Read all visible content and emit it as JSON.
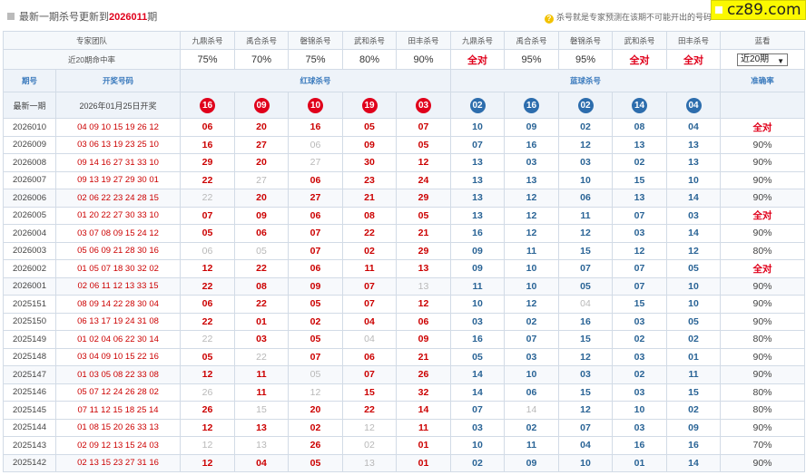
{
  "topbar": {
    "title_prefix": "最新一期杀号更新到",
    "title_period": "2026011",
    "title_suffix": "期",
    "note": "杀号就是专家预测在该期不可能开出的号码",
    "site_badge": "cz89.com"
  },
  "team_row": {
    "label": "专家团队",
    "experts": [
      "九鼎杀号",
      "禹合杀号",
      "磐锦杀号",
      "武和杀号",
      "田丰杀号",
      "九鼎杀号",
      "禹合杀号",
      "磐锦杀号",
      "武和杀号",
      "田丰杀号"
    ],
    "last_label": "蓝看"
  },
  "rate_row": {
    "label": "近20期命中率",
    "rates": [
      "75%",
      "70%",
      "75%",
      "80%",
      "90%",
      "全对",
      "95%",
      "95%",
      "全对",
      "全对"
    ],
    "select_value": "近20期"
  },
  "header_row": {
    "period": "期号",
    "draw": "开奖号码",
    "red_kill": "红球杀号",
    "blue_kill": "蓝球杀号",
    "accuracy": "准确率"
  },
  "latest": {
    "period": "最新一期",
    "draw": "2026年01月25日开奖",
    "red": [
      "16",
      "09",
      "10",
      "19",
      "03"
    ],
    "blue": [
      "02",
      "16",
      "02",
      "14",
      "04"
    ]
  },
  "rows": [
    {
      "period": "2026010",
      "draw": "04 09 10 15 19 26 12",
      "cells": [
        [
          "06",
          "r"
        ],
        [
          "20",
          "r"
        ],
        [
          "16",
          "r"
        ],
        [
          "05",
          "r"
        ],
        [
          "07",
          "r"
        ],
        [
          "10",
          "b"
        ],
        [
          "09",
          "b"
        ],
        [
          "02",
          "b"
        ],
        [
          "08",
          "b"
        ],
        [
          "04",
          "b"
        ]
      ],
      "acc": "全对"
    },
    {
      "period": "2026009",
      "draw": "03 06 13 19 23 25 10",
      "cells": [
        [
          "16",
          "r"
        ],
        [
          "27",
          "r"
        ],
        [
          "06",
          "m"
        ],
        [
          "09",
          "r"
        ],
        [
          "05",
          "r"
        ],
        [
          "07",
          "b"
        ],
        [
          "16",
          "b"
        ],
        [
          "12",
          "b"
        ],
        [
          "13",
          "b"
        ],
        [
          "13",
          "b"
        ]
      ],
      "acc": "90%"
    },
    {
      "period": "2026008",
      "draw": "09 14 16 27 31 33 10",
      "cells": [
        [
          "29",
          "r"
        ],
        [
          "20",
          "r"
        ],
        [
          "27",
          "m"
        ],
        [
          "30",
          "r"
        ],
        [
          "12",
          "r"
        ],
        [
          "13",
          "b"
        ],
        [
          "03",
          "b"
        ],
        [
          "03",
          "b"
        ],
        [
          "02",
          "b"
        ],
        [
          "13",
          "b"
        ]
      ],
      "acc": "90%"
    },
    {
      "period": "2026007",
      "draw": "09 13 19 27 29 30 01",
      "cells": [
        [
          "22",
          "r"
        ],
        [
          "27",
          "m"
        ],
        [
          "06",
          "r"
        ],
        [
          "23",
          "r"
        ],
        [
          "24",
          "r"
        ],
        [
          "13",
          "b"
        ],
        [
          "13",
          "b"
        ],
        [
          "10",
          "b"
        ],
        [
          "15",
          "b"
        ],
        [
          "10",
          "b"
        ]
      ],
      "acc": "90%"
    },
    {
      "period": "2026006",
      "draw": "02 06 22 23 24 28 15",
      "cells": [
        [
          "22",
          "m"
        ],
        [
          "20",
          "r"
        ],
        [
          "27",
          "r"
        ],
        [
          "21",
          "r"
        ],
        [
          "29",
          "r"
        ],
        [
          "13",
          "b"
        ],
        [
          "12",
          "b"
        ],
        [
          "06",
          "b"
        ],
        [
          "13",
          "b"
        ],
        [
          "14",
          "b"
        ]
      ],
      "acc": "90%"
    },
    {
      "period": "2026005",
      "draw": "01 20 22 27 30 33 10",
      "cells": [
        [
          "07",
          "r"
        ],
        [
          "09",
          "r"
        ],
        [
          "06",
          "r"
        ],
        [
          "08",
          "r"
        ],
        [
          "05",
          "r"
        ],
        [
          "13",
          "b"
        ],
        [
          "12",
          "b"
        ],
        [
          "11",
          "b"
        ],
        [
          "07",
          "b"
        ],
        [
          "03",
          "b"
        ]
      ],
      "acc": "全对"
    },
    {
      "period": "2026004",
      "draw": "03 07 08 09 15 24 12",
      "cells": [
        [
          "05",
          "r"
        ],
        [
          "06",
          "r"
        ],
        [
          "07",
          "r"
        ],
        [
          "22",
          "r"
        ],
        [
          "21",
          "r"
        ],
        [
          "16",
          "b"
        ],
        [
          "12",
          "b"
        ],
        [
          "12",
          "b"
        ],
        [
          "03",
          "b"
        ],
        [
          "14",
          "b"
        ]
      ],
      "acc": "90%"
    },
    {
      "period": "2026003",
      "draw": "05 06 09 21 28 30 16",
      "cells": [
        [
          "06",
          "m"
        ],
        [
          "05",
          "m"
        ],
        [
          "07",
          "r"
        ],
        [
          "02",
          "r"
        ],
        [
          "29",
          "r"
        ],
        [
          "09",
          "b"
        ],
        [
          "11",
          "b"
        ],
        [
          "15",
          "b"
        ],
        [
          "12",
          "b"
        ],
        [
          "12",
          "b"
        ]
      ],
      "acc": "80%"
    },
    {
      "period": "2026002",
      "draw": "01 05 07 18 30 32 02",
      "cells": [
        [
          "12",
          "r"
        ],
        [
          "22",
          "r"
        ],
        [
          "06",
          "r"
        ],
        [
          "11",
          "r"
        ],
        [
          "13",
          "r"
        ],
        [
          "09",
          "b"
        ],
        [
          "10",
          "b"
        ],
        [
          "07",
          "b"
        ],
        [
          "07",
          "b"
        ],
        [
          "05",
          "b"
        ]
      ],
      "acc": "全对"
    },
    {
      "period": "2026001",
      "draw": "02 06 11 12 13 33 15",
      "cells": [
        [
          "22",
          "r"
        ],
        [
          "08",
          "r"
        ],
        [
          "09",
          "r"
        ],
        [
          "07",
          "r"
        ],
        [
          "13",
          "m"
        ],
        [
          "11",
          "b"
        ],
        [
          "10",
          "b"
        ],
        [
          "05",
          "b"
        ],
        [
          "07",
          "b"
        ],
        [
          "10",
          "b"
        ]
      ],
      "acc": "90%"
    },
    {
      "period": "2025151",
      "draw": "08 09 14 22 28 30 04",
      "cells": [
        [
          "06",
          "r"
        ],
        [
          "22",
          "r"
        ],
        [
          "05",
          "r"
        ],
        [
          "07",
          "r"
        ],
        [
          "12",
          "r"
        ],
        [
          "10",
          "b"
        ],
        [
          "12",
          "b"
        ],
        [
          "04",
          "m"
        ],
        [
          "15",
          "b"
        ],
        [
          "10",
          "b"
        ]
      ],
      "acc": "90%"
    },
    {
      "period": "2025150",
      "draw": "06 13 17 19 24 31 08",
      "cells": [
        [
          "22",
          "r"
        ],
        [
          "01",
          "r"
        ],
        [
          "02",
          "r"
        ],
        [
          "04",
          "r"
        ],
        [
          "06",
          "r"
        ],
        [
          "03",
          "b"
        ],
        [
          "02",
          "b"
        ],
        [
          "16",
          "b"
        ],
        [
          "03",
          "b"
        ],
        [
          "05",
          "b"
        ]
      ],
      "acc": "90%"
    },
    {
      "period": "2025149",
      "draw": "01 02 04 06 22 30 14",
      "cells": [
        [
          "22",
          "m"
        ],
        [
          "03",
          "r"
        ],
        [
          "05",
          "r"
        ],
        [
          "04",
          "m"
        ],
        [
          "09",
          "r"
        ],
        [
          "16",
          "b"
        ],
        [
          "07",
          "b"
        ],
        [
          "15",
          "b"
        ],
        [
          "02",
          "b"
        ],
        [
          "02",
          "b"
        ]
      ],
      "acc": "80%"
    },
    {
      "period": "2025148",
      "draw": "03 04 09 10 15 22 16",
      "cells": [
        [
          "05",
          "r"
        ],
        [
          "22",
          "m"
        ],
        [
          "07",
          "r"
        ],
        [
          "06",
          "r"
        ],
        [
          "21",
          "r"
        ],
        [
          "05",
          "b"
        ],
        [
          "03",
          "b"
        ],
        [
          "12",
          "b"
        ],
        [
          "03",
          "b"
        ],
        [
          "01",
          "b"
        ]
      ],
      "acc": "90%"
    },
    {
      "period": "2025147",
      "draw": "01 03 05 08 22 33 08",
      "cells": [
        [
          "12",
          "r"
        ],
        [
          "11",
          "r"
        ],
        [
          "05",
          "m"
        ],
        [
          "07",
          "r"
        ],
        [
          "26",
          "r"
        ],
        [
          "14",
          "b"
        ],
        [
          "10",
          "b"
        ],
        [
          "03",
          "b"
        ],
        [
          "02",
          "b"
        ],
        [
          "11",
          "b"
        ]
      ],
      "acc": "90%"
    },
    {
      "period": "2025146",
      "draw": "05 07 12 24 26 28 02",
      "cells": [
        [
          "26",
          "m"
        ],
        [
          "11",
          "r"
        ],
        [
          "12",
          "m"
        ],
        [
          "15",
          "r"
        ],
        [
          "32",
          "r"
        ],
        [
          "14",
          "b"
        ],
        [
          "06",
          "b"
        ],
        [
          "15",
          "b"
        ],
        [
          "03",
          "b"
        ],
        [
          "15",
          "b"
        ]
      ],
      "acc": "80%"
    },
    {
      "period": "2025145",
      "draw": "07 11 12 15 18 25 14",
      "cells": [
        [
          "26",
          "r"
        ],
        [
          "15",
          "m"
        ],
        [
          "20",
          "r"
        ],
        [
          "22",
          "r"
        ],
        [
          "14",
          "r"
        ],
        [
          "07",
          "b"
        ],
        [
          "14",
          "m"
        ],
        [
          "12",
          "b"
        ],
        [
          "10",
          "b"
        ],
        [
          "02",
          "b"
        ]
      ],
      "acc": "80%"
    },
    {
      "period": "2025144",
      "draw": "01 08 15 20 26 33 13",
      "cells": [
        [
          "12",
          "r"
        ],
        [
          "13",
          "r"
        ],
        [
          "02",
          "r"
        ],
        [
          "12",
          "m"
        ],
        [
          "11",
          "r"
        ],
        [
          "03",
          "b"
        ],
        [
          "02",
          "b"
        ],
        [
          "07",
          "b"
        ],
        [
          "03",
          "b"
        ],
        [
          "09",
          "b"
        ]
      ],
      "acc": "90%"
    },
    {
      "period": "2025143",
      "draw": "02 09 12 13 15 24 03",
      "cells": [
        [
          "12",
          "m"
        ],
        [
          "13",
          "m"
        ],
        [
          "26",
          "r"
        ],
        [
          "02",
          "m"
        ],
        [
          "01",
          "r"
        ],
        [
          "10",
          "b"
        ],
        [
          "11",
          "b"
        ],
        [
          "04",
          "b"
        ],
        [
          "16",
          "b"
        ],
        [
          "16",
          "b"
        ]
      ],
      "acc": "70%"
    },
    {
      "period": "2025142",
      "draw": "02 13 15 23 27 31 16",
      "cells": [
        [
          "12",
          "r"
        ],
        [
          "04",
          "r"
        ],
        [
          "05",
          "r"
        ],
        [
          "13",
          "m"
        ],
        [
          "01",
          "r"
        ],
        [
          "02",
          "b"
        ],
        [
          "09",
          "b"
        ],
        [
          "10",
          "b"
        ],
        [
          "01",
          "b"
        ],
        [
          "14",
          "b"
        ]
      ],
      "acc": "90%"
    }
  ]
}
